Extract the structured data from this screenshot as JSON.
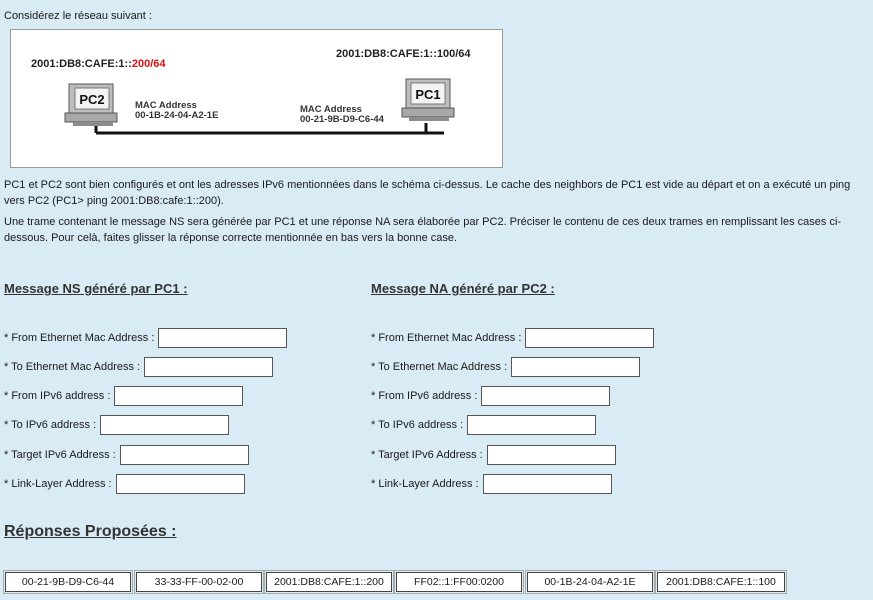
{
  "intro": "Considérez le réseau suivant :",
  "diagram": {
    "pc2_label": "PC2",
    "pc1_label": "PC1",
    "pc2_ipv6_prefix": "2001:DB8:CAFE:1::",
    "pc2_ipv6_host": "200/64",
    "pc1_ipv6": "2001:DB8:CAFE:1::100/64",
    "pc2_mac_title": "MAC Address",
    "pc2_mac": "00-1B-24-04-A2-1E",
    "pc1_mac_title": "MAC Address",
    "pc1_mac": "00-21-9B-D9-C6-44",
    "host_color": "#d11"
  },
  "para1": "PC1 et PC2 sont bien configurés et ont les adresses IPv6 mentionnées dans le schéma ci-dessus. Le cache des neighbors de PC1 est vide au départ et on a exécuté un ping vers PC2 (PC1> ping 2001:DB8:cafe:1::200).",
  "para2": "Une trame contenant le message NS sera générée par PC1 et une réponse NA sera élaborée par PC2. Préciser le contenu de ces deux trames en remplissant les cases  ci-dessous. Pour celà, faites glisser la réponse correcte mentionnée en bas vers la bonne case.",
  "ns": {
    "title": "Message NS généré par PC1 :",
    "fields": [
      {
        "label": "* From Ethernet Mac Address :",
        "value": ""
      },
      {
        "label": "* To Ethernet Mac Address :",
        "value": ""
      },
      {
        "label": "*  From IPv6 address :",
        "value": ""
      },
      {
        "label": "* To IPv6 address :",
        "value": ""
      },
      {
        "label": "* Target IPv6 Address :",
        "value": ""
      },
      {
        "label": "* Link-Layer Address :",
        "value": ""
      }
    ]
  },
  "na": {
    "title": "Message NA généré par PC2 :",
    "fields": [
      {
        "label": "* From Ethernet Mac Address :",
        "value": ""
      },
      {
        "label": "* To Ethernet Mac Address :",
        "value": ""
      },
      {
        "label": "*  From IPv6 address :",
        "value": ""
      },
      {
        "label": "* To IPv6 address :",
        "value": ""
      },
      {
        "label": "* Target IPv6 Address :",
        "value": ""
      },
      {
        "label": "* Link-Layer Address :",
        "value": ""
      }
    ]
  },
  "answers_title": "Réponses Proposées :",
  "answers": [
    "00-21-9B-D9-C6-44",
    "33-33-FF-00-02-00",
    "2001:DB8:CAFE:1::200",
    "FF02::1:FF00:0200",
    "00-1B-24-04-A2-1E",
    "2001:DB8:CAFE:1::100"
  ]
}
